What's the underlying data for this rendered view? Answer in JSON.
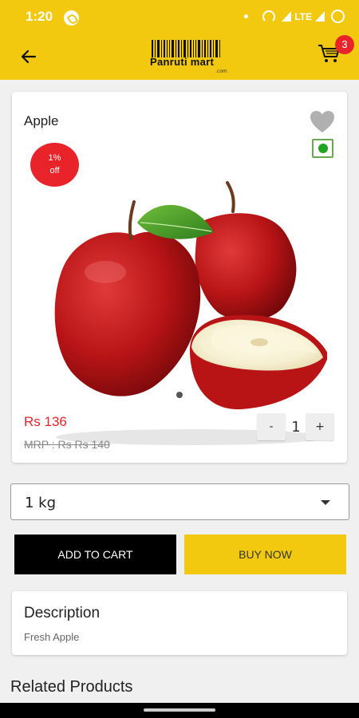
{
  "status": {
    "time": "1:20",
    "network": "LTE"
  },
  "app_bar": {
    "logo_text": "Panruti mart",
    "logo_sub": ".com",
    "cart_count": "3"
  },
  "product": {
    "name": "Apple",
    "discount_percent": "1%",
    "discount_label": "off",
    "price": "Rs 136",
    "mrp": "MRP : Rs Rs 140",
    "quantity": "1",
    "minus_label": "-",
    "plus_label": "+",
    "veg_indicator": "veg",
    "image_slide_count": 1,
    "image": "red apples with a cut half and a leaf"
  },
  "variant": {
    "selected": "1 kg"
  },
  "actions": {
    "add_to_cart": "ADD TO CART",
    "buy_now": "BUY NOW"
  },
  "description": {
    "title": "Description",
    "text": "Fresh Apple"
  },
  "related": {
    "title": "Related Products"
  },
  "colors": {
    "brand_yellow": "#f2c90f",
    "sale_red": "#e8232a",
    "veg_green": "#1fa323"
  }
}
